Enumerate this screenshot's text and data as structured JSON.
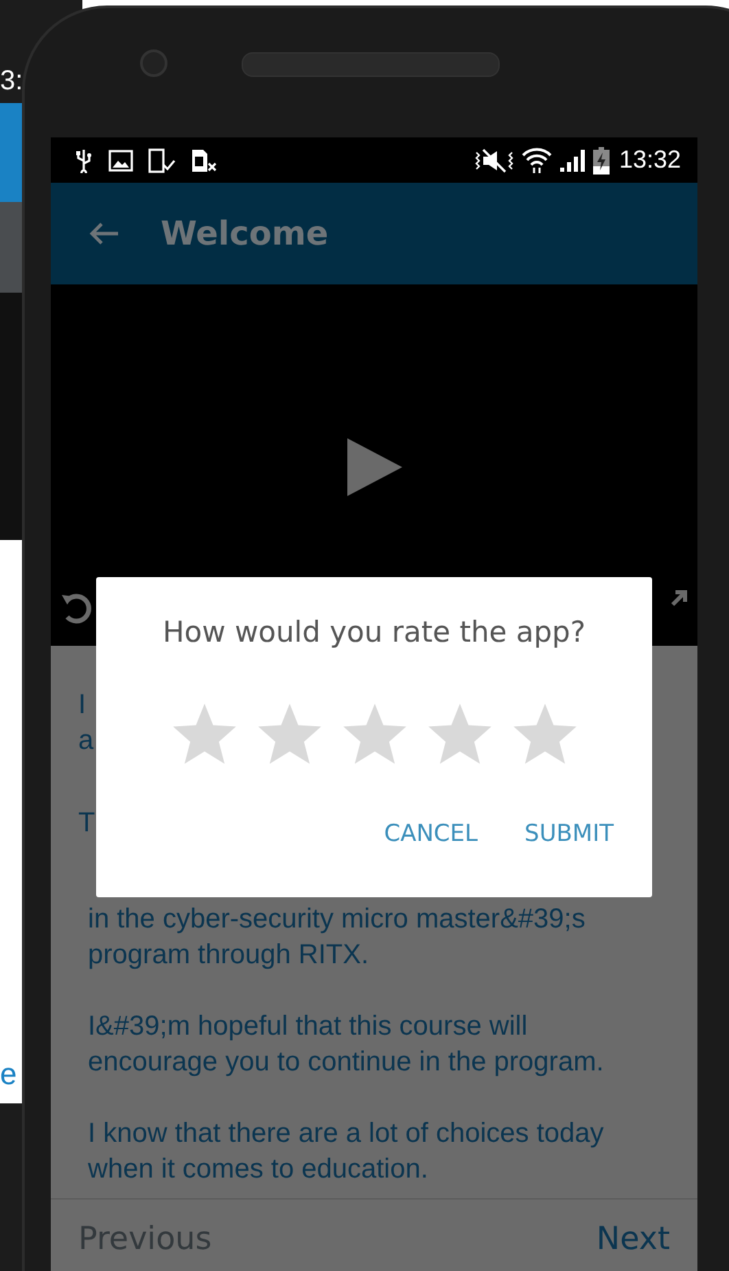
{
  "background_phone": {
    "time_fragment": "3:",
    "text_fragment": "e"
  },
  "status_bar": {
    "time": "13:32"
  },
  "app_bar": {
    "title": "Welcome"
  },
  "content": {
    "lines": [
      {
        "kind": "fragment",
        "text": "I"
      },
      {
        "kind": "fragment",
        "text": "a"
      },
      {
        "kind": "fragment",
        "text": "T"
      },
      {
        "kind": "paragraph",
        "text": "in the cyber-security micro master&#39;s program through RITX."
      },
      {
        "kind": "paragraph",
        "text": "I&#39;m hopeful that this course will encourage you to continue in the program."
      },
      {
        "kind": "paragraph",
        "text": "I know that there are a lot of choices today when it comes to education."
      }
    ]
  },
  "navigation": {
    "previous": {
      "label": "Previous",
      "disabled": true
    },
    "next": {
      "label": "Next",
      "disabled": false
    }
  },
  "dialog": {
    "title": "How would you rate the app?",
    "stars": 0,
    "buttons": [
      "CANCEL",
      "SUBMIT"
    ]
  }
}
